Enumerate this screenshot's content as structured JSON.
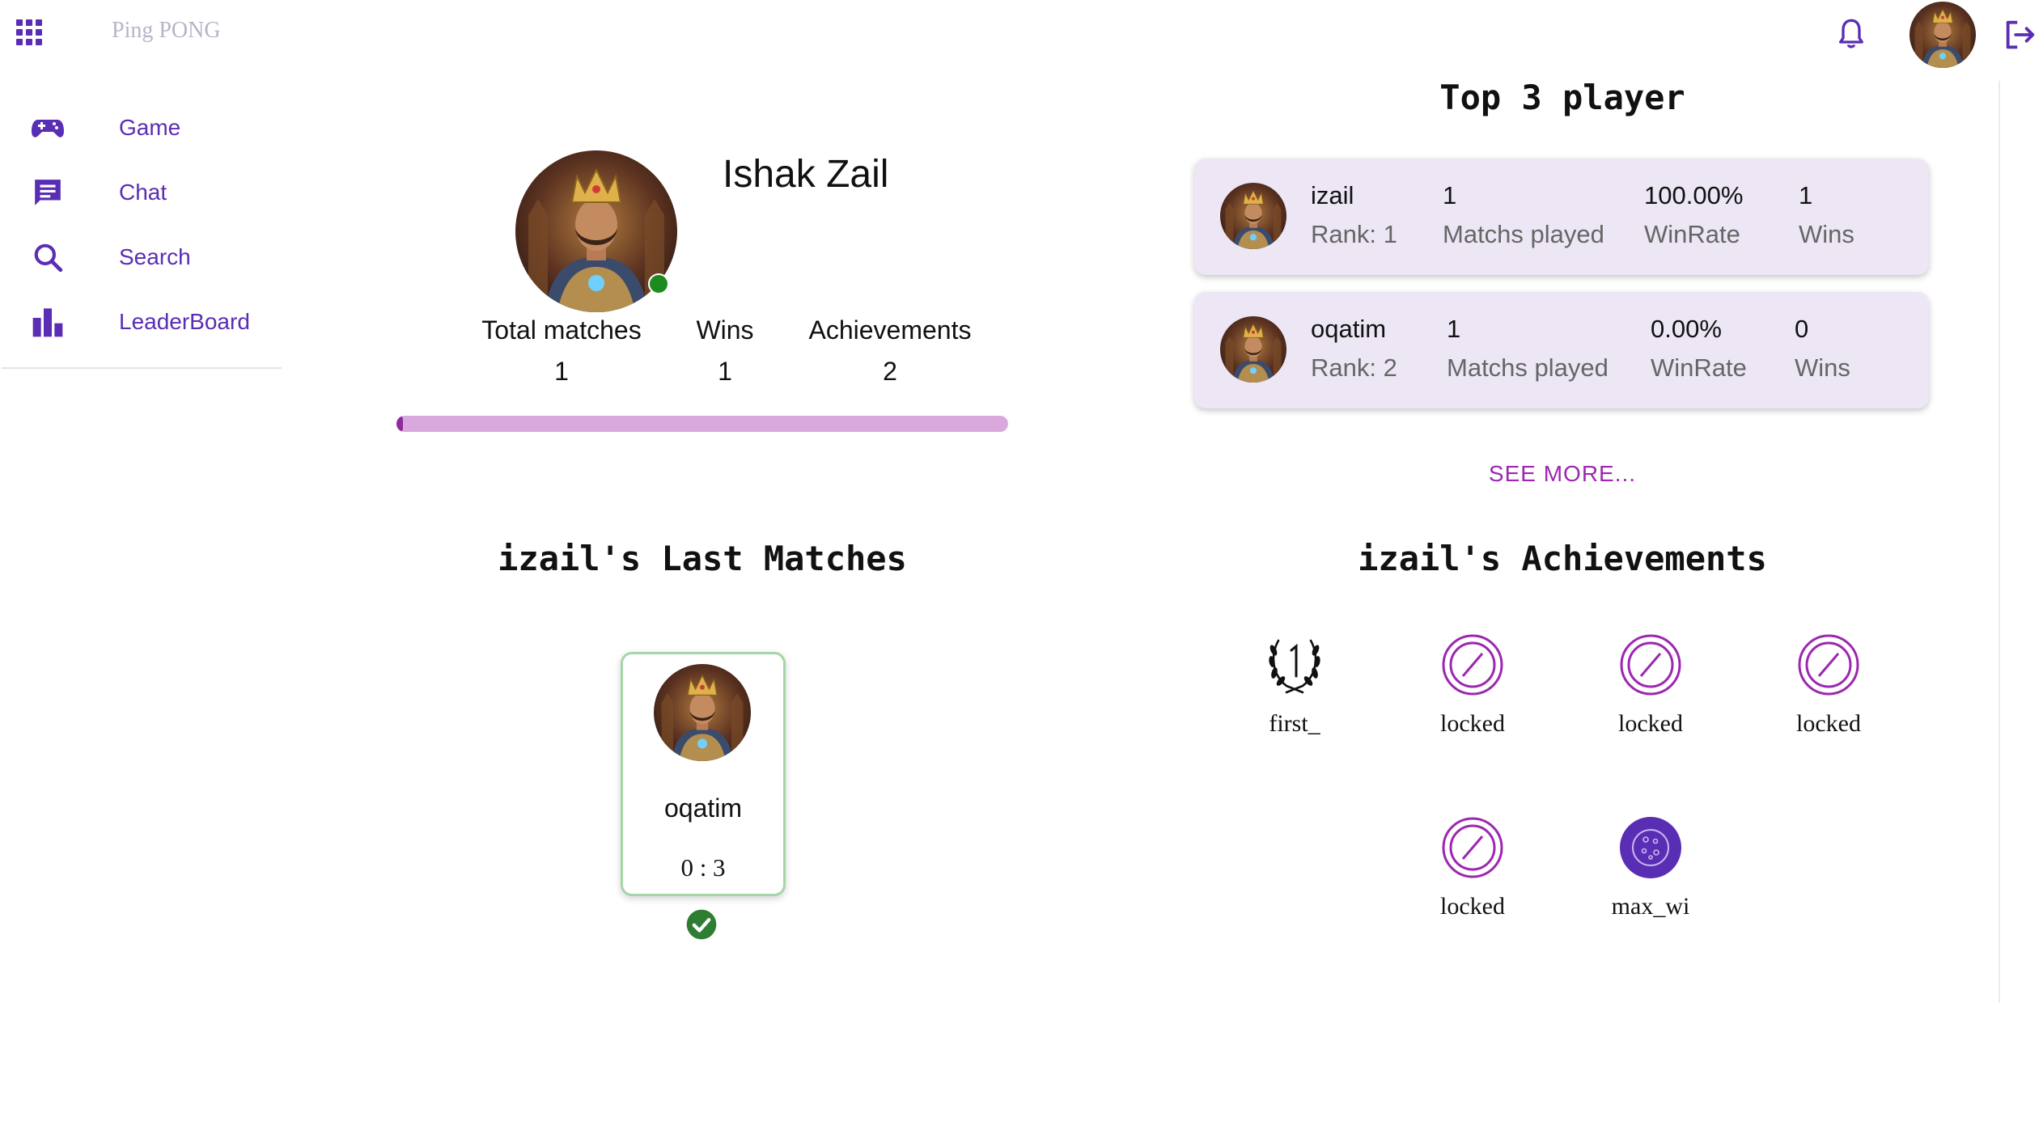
{
  "header": {
    "app_title": "Ping PONG",
    "icons": [
      "apps-icon",
      "bell-icon",
      "logout-icon"
    ]
  },
  "sidebar": {
    "items": [
      {
        "label": "Game",
        "icon": "gamepad-icon"
      },
      {
        "label": "Chat",
        "icon": "chat-icon"
      },
      {
        "label": "Search",
        "icon": "search-icon"
      },
      {
        "label": "LeaderBoard",
        "icon": "leaderboard-icon"
      }
    ]
  },
  "profile": {
    "name": "Ishak Zail",
    "status": "online",
    "stats": [
      {
        "label": "Total matches",
        "value": "1"
      },
      {
        "label": "Wins",
        "value": "1"
      },
      {
        "label": "Achievements",
        "value": "2"
      }
    ],
    "progress_percent": 1
  },
  "top_players": {
    "title": "Top 3 player",
    "players": [
      {
        "username": "izail",
        "rank": "Rank: 1",
        "matches": "1",
        "matches_label": "Matchs played",
        "winrate": "100.00%",
        "winrate_label": "WinRate",
        "wins": "1",
        "wins_label": "Wins"
      },
      {
        "username": "oqatim",
        "rank": "Rank: 2",
        "matches": "1",
        "matches_label": "Matchs played",
        "winrate": "0.00%",
        "winrate_label": "WinRate",
        "wins": "0",
        "wins_label": "Wins"
      }
    ],
    "see_more": "SEE MORE..."
  },
  "last_matches": {
    "title": "izail's Last Matches",
    "matches": [
      {
        "opponent": "oqatim",
        "score": "0 : 3",
        "result": "win"
      }
    ]
  },
  "achievements": {
    "title": "izail's Achievements",
    "items": [
      {
        "label": "first_",
        "icon": "laurel-first-icon"
      },
      {
        "label": "locked",
        "icon": "locked-icon"
      },
      {
        "label": "locked",
        "icon": "locked-icon"
      },
      {
        "label": "locked",
        "icon": "locked-icon"
      },
      {
        "label": "locked",
        "icon": "locked-icon"
      },
      {
        "label": "max_wi",
        "icon": "ball-icon"
      }
    ]
  },
  "colors": {
    "accent": "#5a2db5",
    "link": "#9c27b0",
    "card_bg": "#ede6f5",
    "progress_track": "#d9a9de",
    "online": "#1f8b1f",
    "win": "#2e7d32"
  }
}
